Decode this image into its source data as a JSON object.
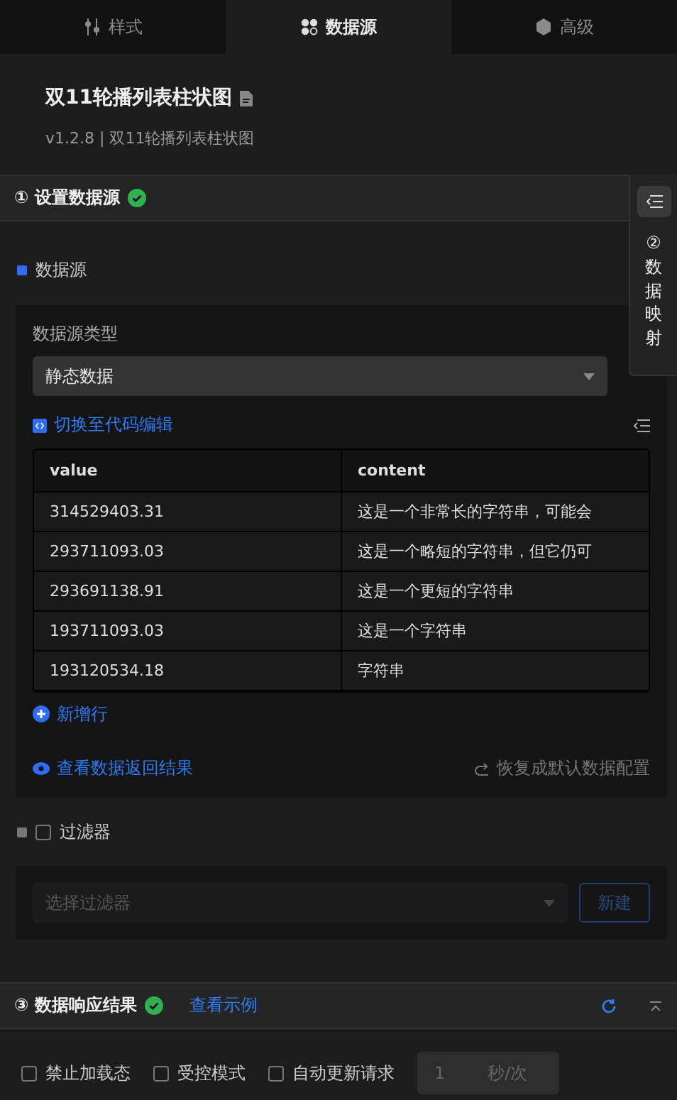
{
  "tabs": [
    {
      "label": "样式",
      "selected": false
    },
    {
      "label": "数据源",
      "selected": true
    },
    {
      "label": "高级",
      "selected": false
    }
  ],
  "component": {
    "title": "双11轮播列表柱状图",
    "subtitle": "v1.2.8 | 双11轮播列表柱状图"
  },
  "section_1": {
    "number": "①",
    "title": "设置数据源",
    "done": true
  },
  "side_tab": {
    "number": "②",
    "label": "数据映射"
  },
  "datasource": {
    "label": "数据源",
    "type_label": "数据源类型",
    "type_value": "静态数据",
    "code_link": "切换至代码编辑",
    "table": {
      "columns": [
        "value",
        "content"
      ],
      "rows": [
        [
          "314529403.31",
          "这是一个非常长的字符串，可能会"
        ],
        [
          "293711093.03",
          "这是一个略短的字符串，但它仍可"
        ],
        [
          "293691138.91",
          "这是一个更短的字符串"
        ],
        [
          "193711093.03",
          "这是一个字符串"
        ],
        [
          "193120534.18",
          "字符串"
        ]
      ]
    },
    "add_row": "新增行",
    "view_result": "查看数据返回结果",
    "reset": "恢复成默认数据配置"
  },
  "filter": {
    "label": "过滤器",
    "checked": false,
    "placeholder": "选择过滤器",
    "new_button": "新建",
    "disabled": true
  },
  "section_3": {
    "number": "③",
    "title": "数据响应结果",
    "done": true,
    "example_link": "查看示例"
  },
  "options": [
    {
      "label": "禁止加载态",
      "checked": false
    },
    {
      "label": "受控模式",
      "checked": false
    },
    {
      "label": "自动更新请求",
      "checked": false
    }
  ],
  "interval": {
    "value": "1",
    "unit": "秒/次"
  }
}
